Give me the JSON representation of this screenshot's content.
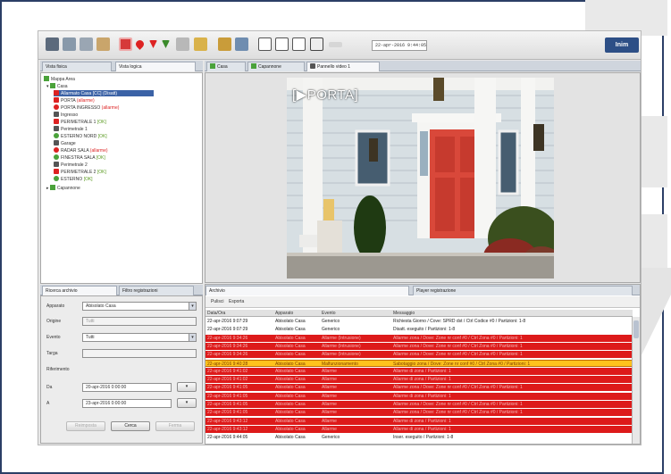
{
  "toolbar": {
    "datetime": "22-apr-2016 9:44:05",
    "logo": "Inim",
    "buttons": [
      "users-icon",
      "sensors-icon",
      "zones-icon",
      "calendar-icon",
      "alarm-panel-icon",
      "heart-icon",
      "shield-icon",
      "doc-icon",
      "folder-icon",
      "tools-icon",
      "map-icon",
      "grid-icon",
      "layout-icon",
      "screen-icon",
      "video-icon"
    ]
  },
  "left_tabs": [
    "Vista fisica",
    "Vista logica"
  ],
  "center_tabs": [
    "Casa",
    "Capannone",
    "Pannello video 1"
  ],
  "tree": {
    "root": "Mappa Area",
    "casa": "Casa",
    "items": [
      {
        "label": "Allarmato Casa [CC] (Disatt)",
        "status": "",
        "icon": "red",
        "selected": true
      },
      {
        "label": "PORTA ",
        "status": "(allarme)",
        "icon": "red"
      },
      {
        "label": "PORTA INGRESSO ",
        "status": "(allarme)",
        "icon": "redc"
      },
      {
        "label": "Ingresso",
        "status": "",
        "icon": "cam"
      },
      {
        "label": "PERIMETRALE 1 ",
        "status": "[OK]",
        "icon": "red"
      },
      {
        "label": "Perimetrale 1",
        "status": "",
        "icon": "cam"
      },
      {
        "label": "ESTERNO NORD ",
        "status": "[OK]",
        "icon": "grn"
      },
      {
        "label": "Garage",
        "status": "",
        "icon": "cam"
      },
      {
        "label": "RADAR SALA ",
        "status": "(allarme)",
        "icon": "redc"
      },
      {
        "label": "FINESTRA SALA ",
        "status": "[OK]",
        "icon": "grn"
      },
      {
        "label": "Perimetrale 2",
        "status": "",
        "icon": "cam"
      },
      {
        "label": "PERIMETRALE 2 ",
        "status": "[OK]",
        "icon": "red"
      },
      {
        "label": "ESTERNO ",
        "status": "[OK]",
        "icon": "grn"
      }
    ],
    "capannone": "Capannone"
  },
  "filter": {
    "tabs": [
      "Ricerca archivio",
      "Filtro registrazioni"
    ],
    "apparato_label": "Apparato",
    "apparato_value": "Abisolato Casa",
    "origine_label": "Origine",
    "origine_value": "Tutti",
    "evento_label": "Evento",
    "evento_value": "Tutti",
    "targa_label": "Targa",
    "riferimento_label": "Riferimento",
    "da_label": "Da",
    "da_value": "20-apr-2016 0:00:00",
    "a_label": "A",
    "a_value": "23-apr-2016 0:00:00",
    "btn_reset": "Reimposta",
    "btn_search": "Cerca",
    "btn_stop": "Ferma"
  },
  "video": {
    "overlay": "[▶PORTA]"
  },
  "events": {
    "tabs": [
      "Archivio",
      "Player registrazione"
    ],
    "menu": [
      "Pulisci",
      "Esporta"
    ],
    "columns": [
      "Data/Ora",
      "Apparato",
      "Evento",
      "Messaggio"
    ],
    "rows": [
      {
        "date": "22-apr-2016 9:07:29",
        "device": "Abisolato Casa",
        "event": "Generico",
        "msg": "Richiesta Giorno / Cove: SPRD dst / Ctrl Codice #0 / Partizioni: 1-8",
        "type": "normal"
      },
      {
        "date": "22-apr-2016 9:07:29",
        "device": "Abisolato Casa",
        "event": "Generico",
        "msg": "Disatt. eseguito / Partizioni: 1-8",
        "type": "normal"
      },
      {
        "date": "22-apr-2016 9:34:26",
        "device": "Abisolato Casa",
        "event": "Allarme (Intrusione)",
        "msg": "Allarme zona / Dove: Zone nr conf #0 / Ctrl Zona #0 / Partizioni: 1",
        "type": "alarm"
      },
      {
        "date": "22-apr-2016 9:34:26",
        "device": "Abisolato Casa",
        "event": "Allarme (Intrusione)",
        "msg": "Allarme zona / Dove: Zone nr conf #0 / Ctrl Zona #0 / Partizioni: 1",
        "type": "alarm"
      },
      {
        "date": "22-apr-2016 9:34:26",
        "device": "Abisolato Casa",
        "event": "Allarme (Intrusione)",
        "msg": "Allarme zona / Dove: Zone nr conf #0 / Ctrl Zona #0 / Partizioni: 1",
        "type": "alarm"
      },
      {
        "date": "22-apr-2016 9:40:28",
        "device": "Abisolato Casa",
        "event": "Malfunzionamento",
        "msg": "Sabotaggio zona / Dove: Zone nr conf #0 / Ctrl Zona #0 / Partizioni: 1",
        "type": "warn"
      },
      {
        "date": "22-apr-2016 9:41:02",
        "device": "Abisolato Casa",
        "event": "Allarme",
        "msg": "Allarme di zona / Partizioni: 1",
        "type": "alarm"
      },
      {
        "date": "22-apr-2016 9:41:02",
        "device": "Abisolato Casa",
        "event": "Allarme",
        "msg": "Allarme di zona / Partizioni: 1",
        "type": "alarm"
      },
      {
        "date": "22-apr-2016 9:41:05",
        "device": "Abisolato Casa",
        "event": "Allarme",
        "msg": "Allarme zona / Dove: Zone nr conf #0 / Ctrl Zona #0 / Partizioni: 1",
        "type": "alarm"
      },
      {
        "date": "22-apr-2016 9:41:05",
        "device": "Abisolato Casa",
        "event": "Allarme",
        "msg": "Allarme di zona / Partizioni: 1",
        "type": "alarm"
      },
      {
        "date": "22-apr-2016 9:41:05",
        "device": "Abisolato Casa",
        "event": "Allarme",
        "msg": "Allarme zona / Dove: Zone nr conf #0 / Ctrl Zona #0 / Partizioni: 1",
        "type": "alarm"
      },
      {
        "date": "22-apr-2016 9:41:05",
        "device": "Abisolato Casa",
        "event": "Allarme",
        "msg": "Allarme zona / Dove: Zone nr conf #0 / Ctrl Zona #0 / Partizioni: 1",
        "type": "alarm"
      },
      {
        "date": "22-apr-2016 9:43:12",
        "device": "Abisolato Casa",
        "event": "Allarme",
        "msg": "Allarme di zona / Partizioni: 1",
        "type": "alarm"
      },
      {
        "date": "22-apr-2016 9:43:12",
        "device": "Abisolato Casa",
        "event": "Allarme",
        "msg": "Allarme di zona / Partizioni: 1",
        "type": "alarm"
      },
      {
        "date": "22-apr-2016 9:44:05",
        "device": "Abisolato Casa",
        "event": "Generico",
        "msg": "Inser. eseguito / Partizioni: 1-8",
        "type": "normal"
      }
    ]
  },
  "colors": {
    "frame": "#2b3f66",
    "alarm": "#dd1a1a",
    "warn": "#ffc21c",
    "selected": "#3b62a6"
  }
}
